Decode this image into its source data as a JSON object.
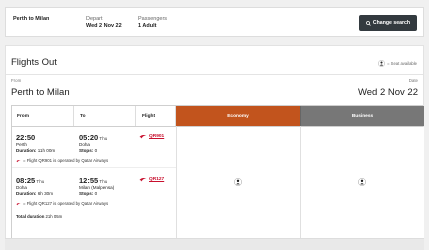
{
  "search": {
    "route": "Perth to Milan",
    "depart_label": "Depart",
    "depart_value": "Wed 2 Nov 22",
    "passengers_label": "Passengers",
    "passengers_value": "1 Adult",
    "change_button": "Change search"
  },
  "panel": {
    "title": "Flights Out",
    "legend": "= Seat available",
    "from_label": "From",
    "date_label": "Date",
    "route": "Perth to Milan",
    "date": "Wed 2 Nov 22"
  },
  "table": {
    "headers": {
      "from": "From",
      "to": "To",
      "flight": "Flight",
      "economy": "Economy",
      "business": "Business"
    },
    "segments": [
      {
        "dep_time": "22:50",
        "dep_city": "Perth",
        "duration_label": "Duration:",
        "duration": "11h 00m",
        "arr_time": "05:20",
        "arr_day": "Thu",
        "arr_city": "Doha",
        "stops_label": "Stops:",
        "stops": "0",
        "flight": "QR901",
        "operated_by": "= Flight QR901 is operated by Qatar Airways"
      },
      {
        "dep_time": "08:25",
        "dep_day": "Thu",
        "dep_city": "Doha",
        "duration_label": "Duration:",
        "duration": "6h 30m",
        "arr_time": "12:55",
        "arr_day": "Thu",
        "arr_city": "Milan (Malpensa)",
        "stops_label": "Stops:",
        "stops": "0",
        "flight": "QR127",
        "operated_by": "= Flight QR127 is operated by Qatar Airways"
      }
    ],
    "total_duration_label": "Total duration",
    "total_duration": "21h 05m"
  },
  "colors": {
    "economy": "#c2541d",
    "business": "#777777",
    "airline": "#c8102e",
    "button": "#333a3f"
  }
}
